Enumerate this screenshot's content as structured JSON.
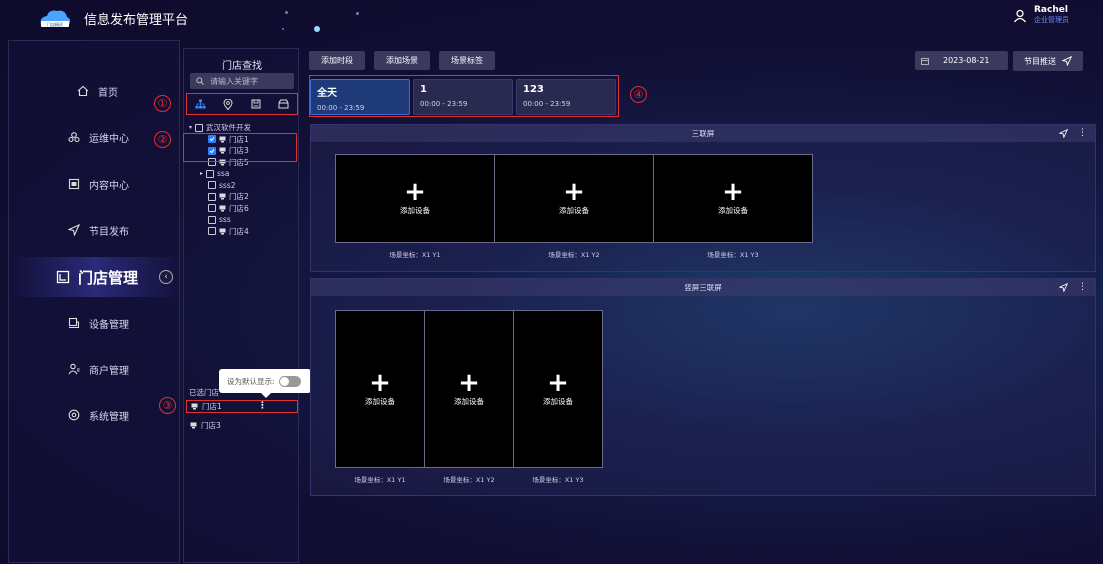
{
  "header": {
    "title": "信息发布管理平台",
    "user_name": "Rachel",
    "user_role": "企业管理员"
  },
  "sidebar": {
    "items": [
      {
        "label": "首页",
        "icon": "home-icon"
      },
      {
        "label": "运维中心",
        "icon": "maintenance-icon"
      },
      {
        "label": "内容中心",
        "icon": "content-icon"
      },
      {
        "label": "节目发布",
        "icon": "send-icon"
      },
      {
        "label": "门店管理",
        "icon": "store-icon",
        "active": true
      },
      {
        "label": "设备管理",
        "icon": "device-icon"
      },
      {
        "label": "商户管理",
        "icon": "merchant-icon"
      },
      {
        "label": "系统管理",
        "icon": "settings-icon"
      }
    ]
  },
  "store_panel": {
    "title": "门店查找",
    "search_placeholder": "请输入关键字",
    "tree": [
      {
        "label": "武汉软件开发",
        "level": 0,
        "checked": false,
        "expanded": true,
        "store": false
      },
      {
        "label": "门店1",
        "level": 1,
        "checked": true,
        "store": true
      },
      {
        "label": "门店3",
        "level": 1,
        "checked": true,
        "store": true
      },
      {
        "label": "门店5",
        "level": 1,
        "checked": false,
        "store": true
      },
      {
        "label": "ssa",
        "level": 1,
        "checked": false,
        "store": false,
        "collapsed": true
      },
      {
        "label": "sss2",
        "level": 1,
        "checked": false,
        "store": false
      },
      {
        "label": "门店2",
        "level": 1,
        "checked": false,
        "store": true
      },
      {
        "label": "门店6",
        "level": 1,
        "checked": false,
        "store": true
      },
      {
        "label": "sss",
        "level": 1,
        "checked": false,
        "store": false
      },
      {
        "label": "门店4",
        "level": 1,
        "checked": false,
        "store": true
      }
    ],
    "selected_label": "已选门店",
    "selected": [
      "门店1",
      "门店3"
    ],
    "default_tooltip": "设为默认显示:"
  },
  "annotations": [
    "①",
    "②",
    "③",
    "④"
  ],
  "toolbar": {
    "add_period": "添加时段",
    "add_scene": "添加场景",
    "scene_tag": "场景标签",
    "date": "2023-08-21",
    "push": "节目推送"
  },
  "time_periods": [
    {
      "name": "全天",
      "time": "00:00 - 23:59",
      "active": true
    },
    {
      "name": "1",
      "time": "00:00 - 23:59",
      "active": false
    },
    {
      "name": "123",
      "time": "00:00 - 23:59",
      "active": false
    }
  ],
  "scenes": [
    {
      "title": "三联屏",
      "add_label": "添加设备",
      "coords": [
        "场景坐标：X1 Y1",
        "场景坐标：X1 Y2",
        "场景坐标：X1 Y3"
      ]
    },
    {
      "title": "竖屏三联屏",
      "add_label": "添加设备",
      "coords": [
        "场景坐标：X1 Y1",
        "场景坐标：X1 Y2",
        "场景坐标：X1 Y3"
      ]
    }
  ],
  "colors": {
    "accent": "#2e7dff",
    "annotation_red": "#e23030",
    "background": "#120f34"
  }
}
